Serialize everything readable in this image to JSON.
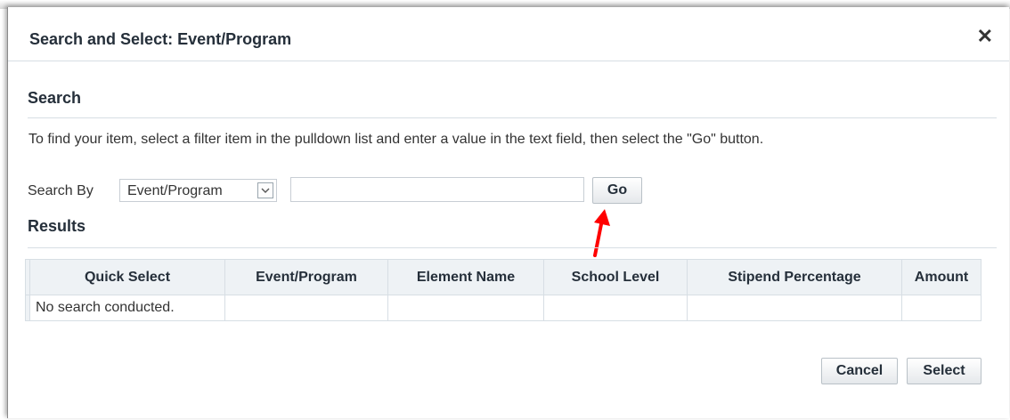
{
  "dialog": {
    "title": "Search and Select: Event/Program",
    "close_glyph": "✕"
  },
  "search": {
    "heading": "Search",
    "instructions": "To find your item, select a filter item in the pulldown list and enter a value in the text field, then select the \"Go\" button.",
    "search_by_label": "Search By",
    "filter_selected": "Event/Program",
    "value": "",
    "go_label": "Go"
  },
  "annotation": {
    "arrow_color": "#ff0000"
  },
  "results": {
    "heading": "Results",
    "columns": [
      "Quick Select",
      "Event/Program",
      "Element Name",
      "School Level",
      "Stipend Percentage",
      "Amount"
    ],
    "empty_message": "No search conducted."
  },
  "footer": {
    "cancel_label": "Cancel",
    "select_label": "Select"
  },
  "colors": {
    "header_bg": "#eef2f5",
    "border": "#d7dee4",
    "title_text": "#252f3a"
  }
}
